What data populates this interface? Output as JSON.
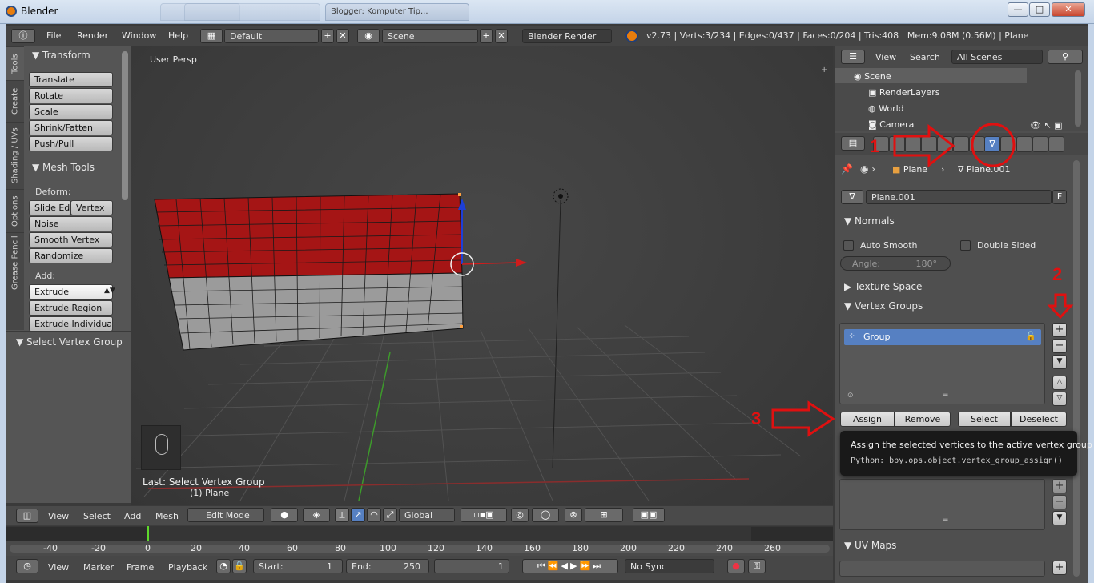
{
  "window": {
    "title": "Blender",
    "tabs": [
      "",
      "",
      "Blogger: Komputer Tip..."
    ],
    "buttons": {
      "minimize": "—",
      "maximize": "□",
      "close": "✕"
    }
  },
  "info_header": {
    "menus": [
      "File",
      "Render",
      "Window",
      "Help"
    ],
    "layout": "Default",
    "scene": "Scene",
    "engine": "Blender Render",
    "stats": "v2.73 | Verts:3/234 | Edges:0/437 | Faces:0/204 | Tris:408 | Mem:9.08M (0.56M) | Plane"
  },
  "toolshelf": {
    "tabs": [
      "Tools",
      "Create",
      "Shading / UVs",
      "Options",
      "Grease Pencil"
    ],
    "transform": {
      "title": "Transform",
      "buttons": [
        "Translate",
        "Rotate",
        "Scale",
        "Shrink/Fatten",
        "Push/Pull"
      ]
    },
    "mesh_tools": {
      "title": "Mesh Tools",
      "deform_label": "Deform:",
      "slide_edge": "Slide Ed",
      "vertex": "Vertex",
      "noise": "Noise",
      "smooth_vertex": "Smooth Vertex",
      "randomize": "Randomize",
      "add_label": "Add:",
      "extrude": "Extrude",
      "extrude_region": "Extrude Region",
      "extrude_individual": "Extrude Individual"
    },
    "operator_panel": "Select Vertex Group"
  },
  "viewport": {
    "view_label": "User Persp",
    "last_op": "Last: Select Vertex Group",
    "object_label": "(1) Plane",
    "header": {
      "menus": [
        "View",
        "Select",
        "Add",
        "Mesh"
      ],
      "mode": "Edit Mode",
      "orientation": "Global"
    }
  },
  "timeline": {
    "ruler": [
      "-40",
      "-20",
      "0",
      "20",
      "40",
      "60",
      "80",
      "100",
      "120",
      "140",
      "160",
      "180",
      "200",
      "220",
      "240",
      "260"
    ],
    "menus": [
      "View",
      "Marker",
      "Frame",
      "Playback"
    ],
    "start_label": "Start:",
    "start_value": "1",
    "end_label": "End:",
    "end_value": "250",
    "current_frame": "1",
    "sync": "No Sync"
  },
  "outliner": {
    "menus": [
      "View",
      "Search"
    ],
    "filter": "All Scenes",
    "rows": [
      "Scene",
      "RenderLayers",
      "World",
      "Camera"
    ]
  },
  "properties": {
    "breadcrumb": {
      "object": "Plane",
      "mesh": "Plane.001"
    },
    "datablock": "Plane.001",
    "fake_user": "F",
    "normals": {
      "title": "Normals",
      "auto_smooth": "Auto Smooth",
      "double_sided": "Double Sided",
      "angle_label": "Angle:",
      "angle_value": "180°"
    },
    "texture_space": "Texture Space",
    "vertex_groups": {
      "title": "Vertex Groups",
      "items": [
        "Group"
      ],
      "assign": "Assign",
      "remove": "Remove",
      "select": "Select",
      "deselect": "Deselect"
    },
    "uv_maps": "UV Maps"
  },
  "tooltip": {
    "text": "Assign the selected vertices to the active vertex group",
    "python": "Python: bpy.ops.object.vertex_group_assign()"
  },
  "annotations": {
    "step1": "1",
    "step2": "2",
    "step3": "3"
  },
  "colors": {
    "accent": "#5680c2",
    "annotation": "#e01010",
    "selected_faces": "#a51515"
  }
}
